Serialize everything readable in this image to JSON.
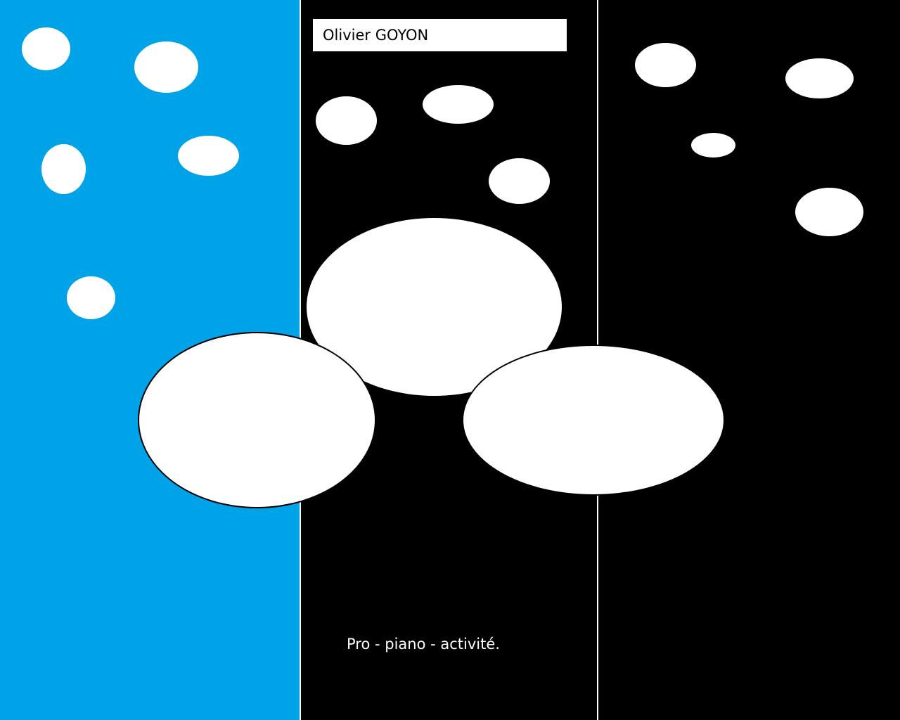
{
  "colors": {
    "left_panel": "#00a2e8",
    "middle_panel": "#000000",
    "right_panel": "#000000",
    "bubbles": "#ffffff",
    "dividers": "#ffffff",
    "name_box_background": "#ffffff",
    "name_text": "#000000",
    "caption_text": "#ffffff"
  },
  "name_box": {
    "text": "Olivier GOYON"
  },
  "caption": {
    "text": "Pro - piano - activité."
  }
}
